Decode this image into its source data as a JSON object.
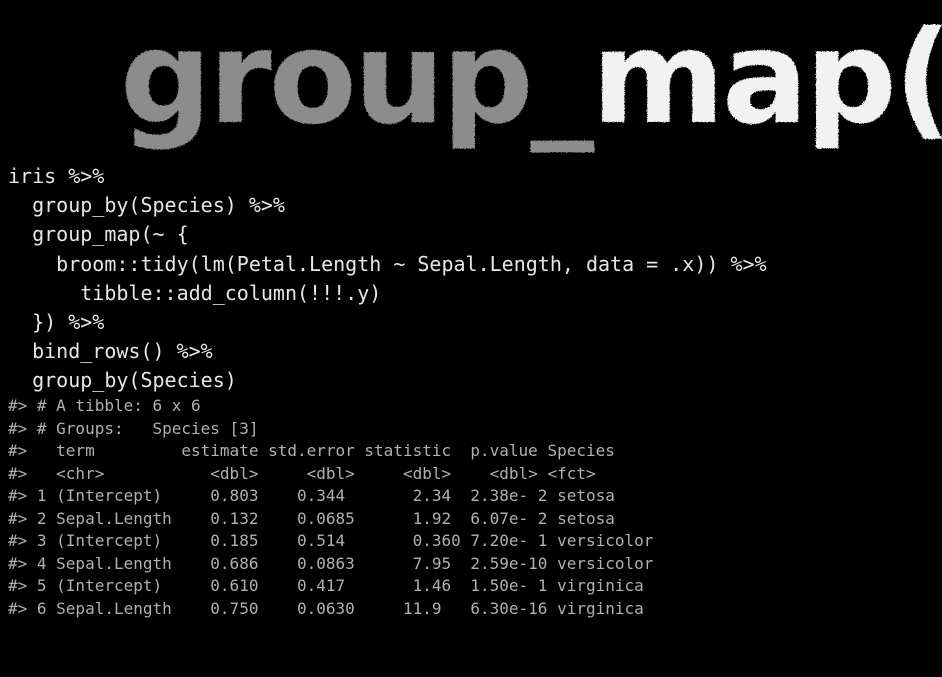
{
  "title": {
    "part1": "group_",
    "part2": "map()",
    "colors": {
      "part1": "#8c8c8c",
      "part2": "#f2f2f2"
    }
  },
  "code_lines": [
    "iris %>%",
    "  group_by(Species) %>%",
    "  group_map(~ {",
    "    broom::tidy(lm(Petal.Length ~ Sepal.Length, data = .x)) %>%",
    "      tibble::add_column(!!!.y)",
    "  }) %>%",
    "  bind_rows() %>%",
    "  group_by(Species)"
  ],
  "output_lines": [
    "#> # A tibble: 6 x 6",
    "#> # Groups:   Species [3]",
    "#>   term         estimate std.error statistic  p.value Species",
    "#>   <chr>           <dbl>     <dbl>     <dbl>    <dbl> <fct>",
    "#> 1 (Intercept)     0.803    0.344       2.34  2.38e- 2 setosa",
    "#> 2 Sepal.Length    0.132    0.0685      1.92  6.07e- 2 setosa",
    "#> 3 (Intercept)     0.185    0.514       0.360 7.20e- 1 versicolor",
    "#> 4 Sepal.Length    0.686    0.0863      7.95  2.59e-10 versicolor",
    "#> 5 (Intercept)     0.610    0.417       1.46  1.50e- 1 virginica",
    "#> 6 Sepal.Length    0.750    0.0630     11.9   6.30e-16 virginica"
  ],
  "colors": {
    "background": "#000000",
    "code": "#e6e6e6",
    "output": "#b0b0b0"
  }
}
